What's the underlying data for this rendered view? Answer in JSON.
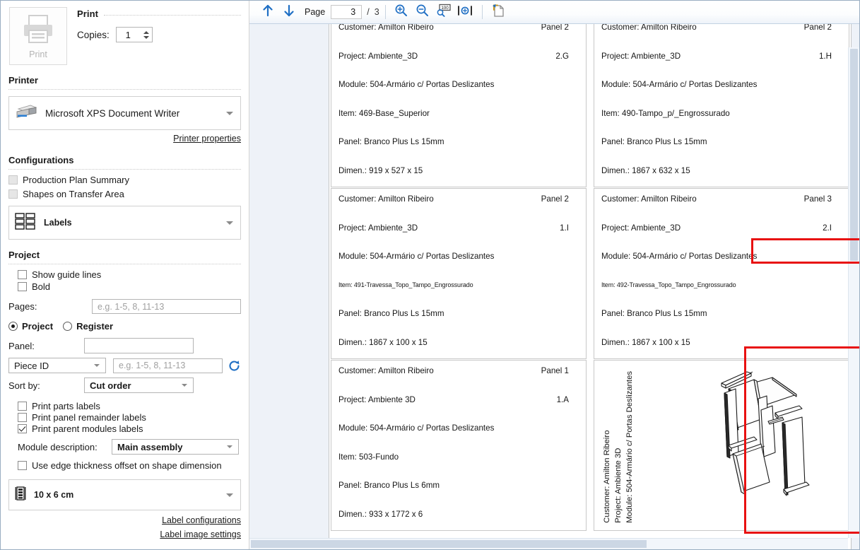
{
  "sidebar": {
    "print": {
      "button_label": "Print",
      "section_title": "Print",
      "copies_label": "Copies:",
      "copies_value": "1"
    },
    "printer": {
      "section_title": "Printer",
      "selected": "Microsoft XPS Document Writer",
      "properties_link": "Printer properties"
    },
    "configurations": {
      "section_title": "Configurations",
      "checkboxes": [
        {
          "label": "Production Plan Summary",
          "checked": false,
          "disabled": true
        },
        {
          "label": "Shapes on Transfer Area",
          "checked": false,
          "disabled": true
        }
      ],
      "mode_combo": "Labels"
    },
    "project": {
      "section_title": "Project",
      "checkboxes": [
        {
          "label": "Show guide lines",
          "checked": false
        },
        {
          "label": "Bold",
          "checked": false
        }
      ],
      "pages_label": "Pages:",
      "pages_placeholder": "e.g. 1-5, 8, 11-13",
      "pages_value": "",
      "radio_project": "Project",
      "radio_register": "Register",
      "radio_selected": "Project",
      "panel_label": "Panel:",
      "panel_value": "",
      "filter_type": "Piece ID",
      "filter_placeholder": "e.g. 1-5, 8, 11-13",
      "filter_value": "",
      "sort_label": "Sort by:",
      "sort_value": "Cut order",
      "print_checkboxes": [
        {
          "label": "Print parts labels",
          "checked": false
        },
        {
          "label": "Print panel remainder labels",
          "checked": false
        },
        {
          "label": "Print parent modules labels",
          "checked": true
        }
      ],
      "module_desc_label": "Module description:",
      "module_desc_value": "Main assembly",
      "edge_offset": {
        "label": "Use edge thickness offset on shape dimension",
        "checked": false
      },
      "label_size": "10 x 6 cm",
      "label_configurations_link": "Label configurations",
      "label_image_settings_link": "Label image settings"
    }
  },
  "toolbar": {
    "prev_page_icon": "arrow-up-icon",
    "next_page_icon": "arrow-down-icon",
    "page_label": "Page",
    "page_current": "3",
    "page_separator": "/",
    "page_total": "3",
    "zoom_in_icon": "zoom-in-icon",
    "zoom_out_icon": "zoom-out-icon",
    "zoom_percent_icon": "zoom-100-icon",
    "fit_width_icon": "fit-width-icon",
    "export_icon": "export-page-icon"
  },
  "preview": {
    "labels": [
      {
        "customer": "Customer: Amilton Ribeiro",
        "panel": "Panel 2",
        "project": "Project: Ambiente_3D",
        "code": "2.G",
        "module": "Module: 504-Armário c/ Portas Deslizantes",
        "item": "Item: 469-Base_Superior",
        "panel_material": "Panel: Branco Plus Ls 15mm",
        "dimension": "Dimen.: 919 x 527 x 15",
        "tiny_item": false
      },
      {
        "customer": "Customer: Amilton Ribeiro",
        "panel": "Panel 2",
        "project": "Project: Ambiente_3D",
        "code": "1.H",
        "module": "Module: 504-Armário c/ Portas Deslizantes",
        "item": "Item: 490-Tampo_p/_Engrossurado",
        "panel_material": "Panel: Branco Plus Ls 15mm",
        "dimension": "Dimen.: 1867 x 632 x 15",
        "tiny_item": false
      },
      {
        "customer": "Customer: Amilton Ribeiro",
        "panel": "Panel 2",
        "project": "Project: Ambiente_3D",
        "code": "1.I",
        "module": "Module: 504-Armário c/ Portas Deslizantes",
        "item": "Item: 491-Travessa_Topo_Tampo_Engrossurado",
        "panel_material": "Panel: Branco Plus Ls 15mm",
        "dimension": "Dimen.: 1867 x 100 x 15",
        "tiny_item": true
      },
      {
        "customer": "Customer: Amilton Ribeiro",
        "panel": "Panel 3",
        "project": "Project: Ambiente_3D",
        "code": "2.I",
        "module": "Module: 504-Armário c/ Portas Deslizantes",
        "item": "Item: 492-Travessa_Topo_Tampo_Engrossurado",
        "panel_material": "Panel: Branco Plus Ls 15mm",
        "dimension": "Dimen.: 1867 x 100 x 15",
        "tiny_item": true
      },
      {
        "customer": "Customer: Amilton Ribeiro",
        "panel": "Panel 1",
        "project": "Project: Ambiente  3D",
        "code": "1.A",
        "module": "Module: 504-Armário c/ Portas Deslizantes",
        "item": "Item: 503-Fundo",
        "panel_material": "Panel: Branco Plus Ls 6mm",
        "dimension": "Dimen.: 933 x 1772 x 6",
        "tiny_item": false
      }
    ],
    "drawing_label": {
      "customer": "Customer: Amilton Ribeiro",
      "project": "Project: Ambiente  3D",
      "module": "Module: 504-Armário c/ Portas Deslizantes"
    }
  },
  "colors": {
    "highlight": "#e81111",
    "accent": "#1f6fc4",
    "panel_bg": "#eef2f8"
  }
}
